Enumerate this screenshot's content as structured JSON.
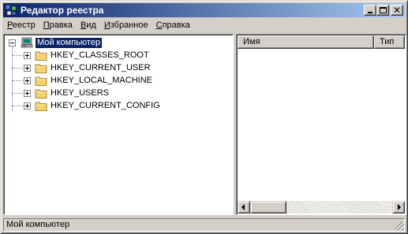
{
  "window": {
    "title": "Редактор реестра",
    "icon": "registry-editor-icon",
    "controls": {
      "minimize": "minimize-icon",
      "maximize": "maximize-icon",
      "close": "✕"
    }
  },
  "menu": [
    "Реестр",
    "Правка",
    "Вид",
    "Избранное",
    "Справка"
  ],
  "tree": {
    "root": {
      "label": "Мой компьютер",
      "icon": "computer-icon",
      "expanded": true,
      "selected": true
    },
    "children": [
      {
        "label": "HKEY_CLASSES_ROOT",
        "icon": "folder-icon"
      },
      {
        "label": "HKEY_CURRENT_USER",
        "icon": "folder-icon"
      },
      {
        "label": "HKEY_LOCAL_MACHINE",
        "icon": "folder-icon"
      },
      {
        "label": "HKEY_USERS",
        "icon": "folder-icon"
      },
      {
        "label": "HKEY_CURRENT_CONFIG",
        "icon": "folder-icon"
      }
    ]
  },
  "list": {
    "columns": [
      "Имя",
      "Тип"
    ]
  },
  "status": {
    "text": "Мой компьютер"
  },
  "colors": {
    "titlebar_start": "#0a246a",
    "titlebar_end": "#a6caf0",
    "face": "#d4d0c8",
    "selection": "#0a246a",
    "folder": "#f5d36b"
  }
}
